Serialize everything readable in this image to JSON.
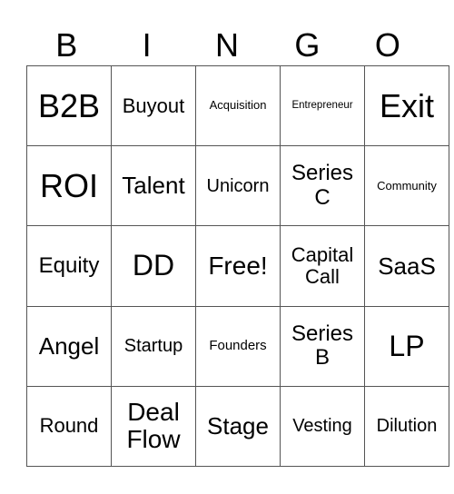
{
  "header": [
    "B",
    "I",
    "N",
    "G",
    "O"
  ],
  "rows": [
    [
      "B2B",
      "Buyout",
      "Acquisition",
      "Entrepreneur",
      "Exit"
    ],
    [
      "ROI",
      "Talent",
      "Unicorn",
      "Series C",
      "Community"
    ],
    [
      "Equity",
      "DD",
      "Free!",
      "Capital Call",
      "SaaS"
    ],
    [
      "Angel",
      "Startup",
      "Founders",
      "Series B",
      "LP"
    ],
    [
      "Round",
      "Deal Flow",
      "Stage",
      "Vesting",
      "Dilution"
    ]
  ]
}
